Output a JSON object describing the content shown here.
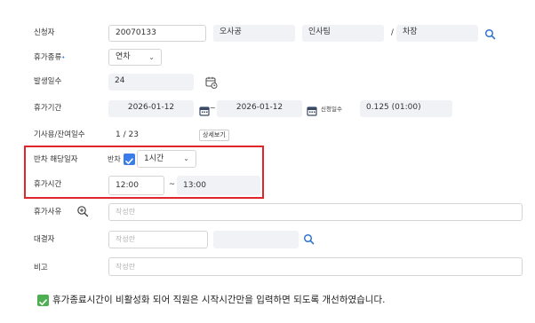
{
  "form": {
    "applicant": {
      "label": "신청자",
      "emp_id": "20070133",
      "name": "오사공",
      "dept": "인사팀",
      "separator": "/",
      "title": "차장"
    },
    "leave_type": {
      "label": "휴가종류",
      "required_mark": "•",
      "value": "연차"
    },
    "days_generated": {
      "label": "발생일수",
      "value": "24"
    },
    "leave_period": {
      "label": "휴가기간",
      "start": "2026-01-12",
      "dash": "~",
      "end": "2026-01-12",
      "request_days_label": "신청일수",
      "request_days_value": "0.125 (01:00)"
    },
    "used_remaining": {
      "label": "기사용/잔여일수",
      "value": "1 / 23",
      "detail_button": "상세보기"
    },
    "half_day": {
      "label": "반차 해당일자",
      "check_label": "반차",
      "checked": true,
      "hours": "1시간"
    },
    "leave_time": {
      "label": "휴가시간",
      "start": "12:00",
      "dash": "~",
      "end": "13:00"
    },
    "reason": {
      "label": "휴가사유",
      "placeholder": "작성란"
    },
    "proxy": {
      "label": "대결자",
      "placeholder": "작성란"
    },
    "remark": {
      "label": "비고",
      "placeholder": "작성란"
    }
  },
  "note": {
    "icon": "check-mark-icon",
    "text": "휴가종료시간이 비활성화 되어 직원은 시작시간만을 입력하면 되도록 개선하였습니다."
  },
  "colors": {
    "accent": "#3b7de8",
    "highlight_border": "#e0262b",
    "input_gray": "#f1f2f5"
  }
}
